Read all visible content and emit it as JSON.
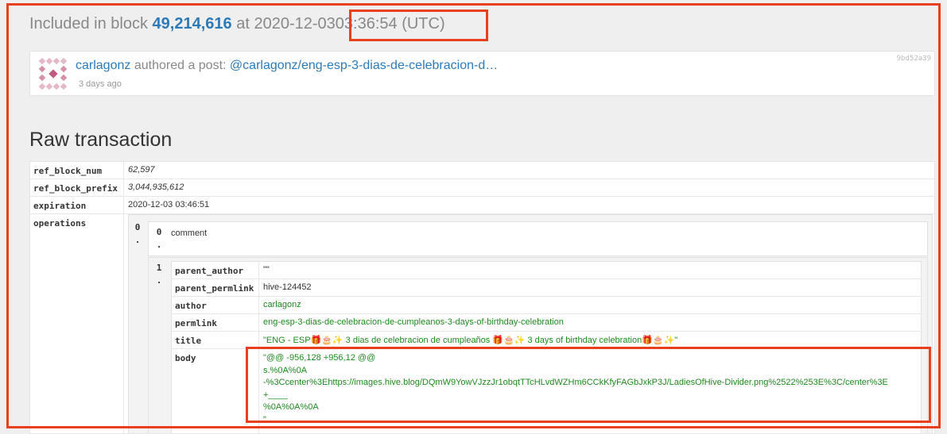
{
  "block": {
    "prefix": "Included in block",
    "number": "49,214,616",
    "at_date": "at 2020-12-03",
    "time": "03:36:54",
    "tz": "(UTC)"
  },
  "post": {
    "author": "carlagonz",
    "action": "authored a post:",
    "link": "@carlagonz/eng-esp-3-dias-de-celebracion-d…",
    "time": "3 days ago",
    "hash": "9bd52a39"
  },
  "raw_title": "Raw transaction",
  "tx": {
    "ref_block_num_key": "ref_block_num",
    "ref_block_num": "62,597",
    "ref_block_prefix_key": "ref_block_prefix",
    "ref_block_prefix": "3,044,935,612",
    "expiration_key": "expiration",
    "expiration": "2020-12-03 03:46:51",
    "operations_key": "operations"
  },
  "op": {
    "index_outer": "0",
    "index0": "0",
    "type": "comment",
    "index1": "1",
    "fields": {
      "parent_author_key": "parent_author",
      "parent_author": "\"\"",
      "parent_permlink_key": "parent_permlink",
      "parent_permlink": "hive-124452",
      "author_key": "author",
      "author": "carlagonz",
      "permlink_key": "permlink",
      "permlink": "eng-esp-3-dias-de-celebracion-de-cumpleanos-3-days-of-birthday-celebration",
      "title_key": "title",
      "title": "\"ENG - ESP🎁🎂✨ 3 dias de celebracion de cumpleaños 🎁🎂✨ 3 days of birthday celebration🎁🎂✨\"",
      "body_key": "body",
      "body_lines": [
        "\"@@ -956,128 +956,12 @@",
        "s.%0A%0A",
        "-%3Ccenter%3Ehttps://images.hive.blog/DQmW9YowVJzzJr1obqtTTcHLvdWZHm6CCkKfyFAGbJxkP3J/LadiesOfHive-Divider.png%2522%253E%3C/center%3E",
        "+____",
        "%0A%0A%0A",
        "\""
      ]
    }
  }
}
